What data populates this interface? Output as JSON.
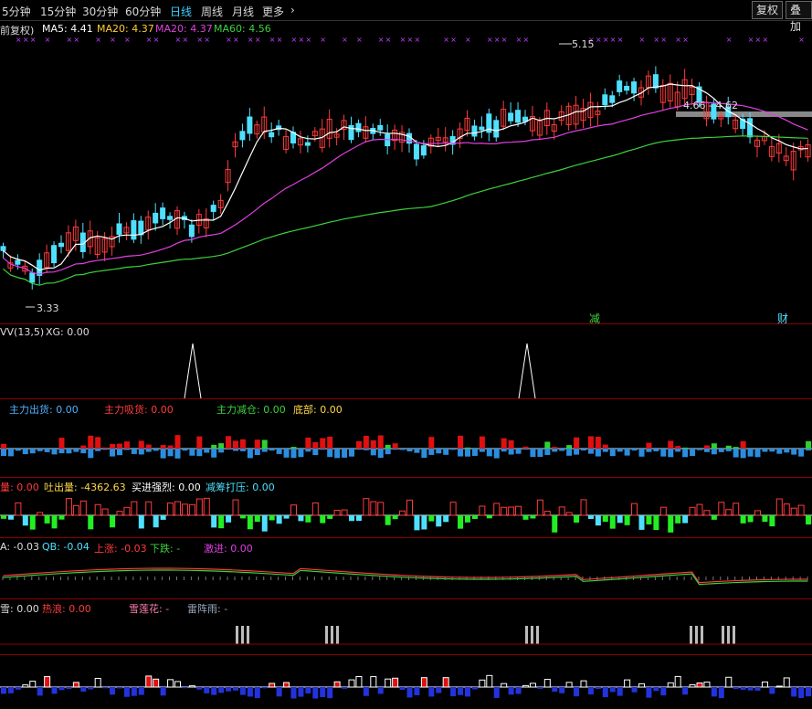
{
  "toolbar": {
    "tabs": [
      {
        "label": "5分钟"
      },
      {
        "label": "15分钟"
      },
      {
        "label": "30分钟"
      },
      {
        "label": "60分钟"
      },
      {
        "label": "日线",
        "active": true
      },
      {
        "label": "周线"
      },
      {
        "label": "月线"
      },
      {
        "label": "更多"
      }
    ],
    "more_chevron": "›",
    "btn_fq": "复权",
    "btn_overlay": "叠加"
  },
  "main": {
    "adj": "前复权)",
    "ma5": "MA5: 4.41",
    "ma20a": "MA20: 4.37",
    "ma20b": "MA20: 4.37",
    "ma60": "MA60: 4.56",
    "high_label": "5.15",
    "low_label": "3.33",
    "range_label": "4.66 - 4.62",
    "tag_jian": "减",
    "tag_cai": "财"
  },
  "ind1": {
    "a": "VV(13,5)",
    "b": "XG: 0.00"
  },
  "ind2": {
    "a": "主力出货: 0.00",
    "b": "主力吸货: 0.00",
    "c": "主力减仓: 0.00",
    "d": "底部: 0.00"
  },
  "ind3": {
    "a": "量: 0.00",
    "b": "吐出量: -4362.63",
    "c": "买进强烈: 0.00",
    "d": "减筹打压: 0.00"
  },
  "ind4": {
    "a": "A: -0.03",
    "b": "QB: -0.04",
    "c": "上涨: -0.03",
    "d": "下跌: -",
    "e": "激进: 0.00"
  },
  "ind5": {
    "a": "雪: 0.00",
    "b": "热浪: 0.00",
    "c": "雪莲花: -",
    "d": "雷阵雨: -"
  },
  "colors": {
    "up": "#ff3b3b",
    "down": "#4fe0ff",
    "ma5": "#ffffff",
    "ma20": "#e040e0",
    "ma60": "#3cd23c"
  }
}
